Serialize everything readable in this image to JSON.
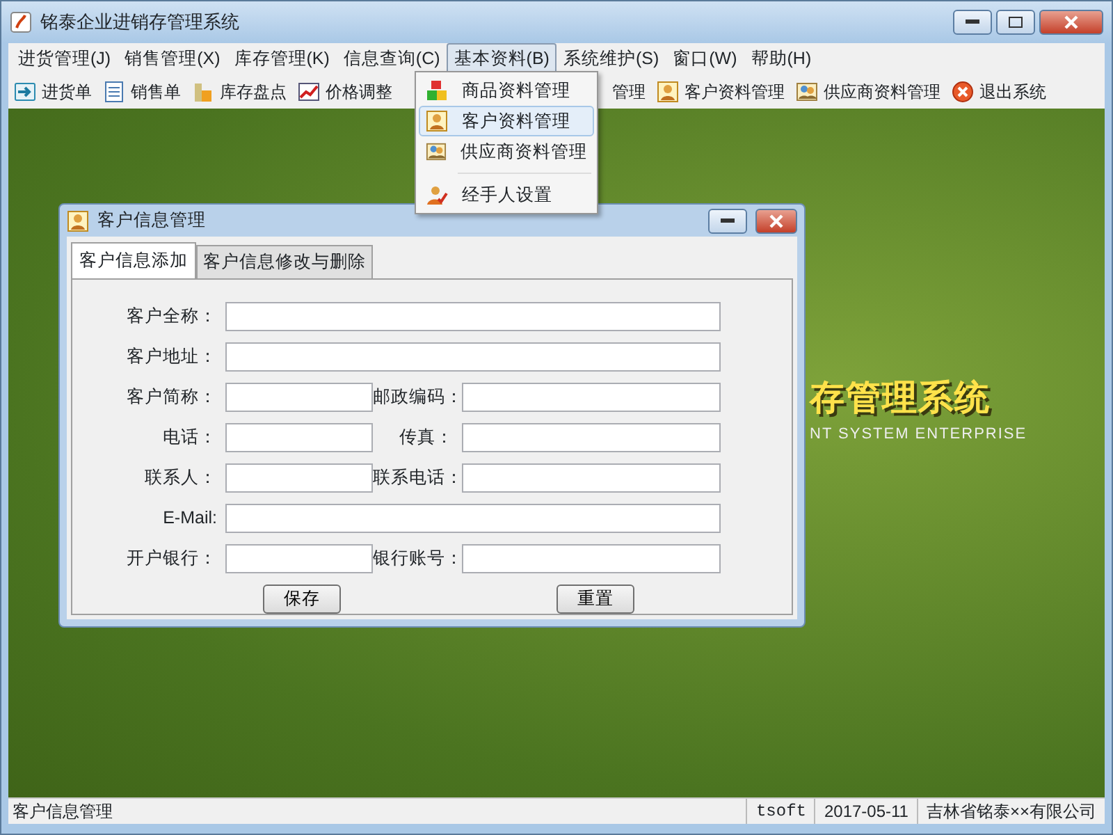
{
  "window": {
    "title": "铭泰企业进销存管理系统"
  },
  "menu": [
    {
      "label": "进货管理(J)",
      "selected": false
    },
    {
      "label": "销售管理(X)",
      "selected": false
    },
    {
      "label": "库存管理(K)",
      "selected": false
    },
    {
      "label": "信息查询(C)",
      "selected": false
    },
    {
      "label": "基本资料(B)",
      "selected": true
    },
    {
      "label": "系统维护(S)",
      "selected": false
    },
    {
      "label": "窗口(W)",
      "selected": false
    },
    {
      "label": "帮助(H)",
      "selected": false
    }
  ],
  "dropdown": [
    {
      "label": "商品资料管理",
      "kind": "item",
      "selected": false
    },
    {
      "label": "客户资料管理",
      "kind": "item",
      "selected": true
    },
    {
      "label": "供应商资料管理",
      "kind": "item",
      "selected": false
    },
    {
      "kind": "separator"
    },
    {
      "label": "经手人设置",
      "kind": "item",
      "selected": false
    }
  ],
  "toolbar": [
    {
      "label": "进货单",
      "covered": false
    },
    {
      "label": "销售单",
      "covered": false
    },
    {
      "label": "库存盘点",
      "covered": false
    },
    {
      "label": "价格调整",
      "covered": false
    },
    {
      "label": "管理",
      "covered": true
    },
    {
      "label": "客户资料管理",
      "covered": false
    },
    {
      "label": "供应商资料管理",
      "covered": false
    },
    {
      "label": "退出系统",
      "covered": false
    }
  ],
  "background_logo": {
    "title": "存管理系统",
    "subtitle": "NT SYSTEM ENTERPRISE"
  },
  "dialog": {
    "title": "客户信息管理",
    "tabs": [
      {
        "label": "客户信息添加",
        "selected": true
      },
      {
        "label": "客户信息修改与删除",
        "selected": false
      }
    ],
    "rows": [
      {
        "kind": "wide",
        "fields": [
          {
            "label": "客户全称："
          }
        ]
      },
      {
        "kind": "wide",
        "fields": [
          {
            "label": "客户地址："
          }
        ]
      },
      {
        "kind": "pair",
        "fields": [
          {
            "label": "客户简称："
          },
          {
            "label": "邮政编码："
          }
        ]
      },
      {
        "kind": "pair",
        "fields": [
          {
            "label": "电话："
          },
          {
            "label": "传真："
          }
        ]
      },
      {
        "kind": "pair",
        "fields": [
          {
            "label": "联系人："
          },
          {
            "label": "联系电话："
          }
        ]
      },
      {
        "kind": "wide",
        "fields": [
          {
            "label": "E-Mail:"
          }
        ]
      },
      {
        "kind": "pair",
        "fields": [
          {
            "label": "开户银行："
          },
          {
            "label": "银行账号："
          }
        ]
      }
    ],
    "buttons": [
      "保存",
      "重置"
    ]
  },
  "status_bar": [
    "客户信息管理",
    "tsoft",
    "2017-05-11",
    "吉林省铭泰××有限公司"
  ]
}
